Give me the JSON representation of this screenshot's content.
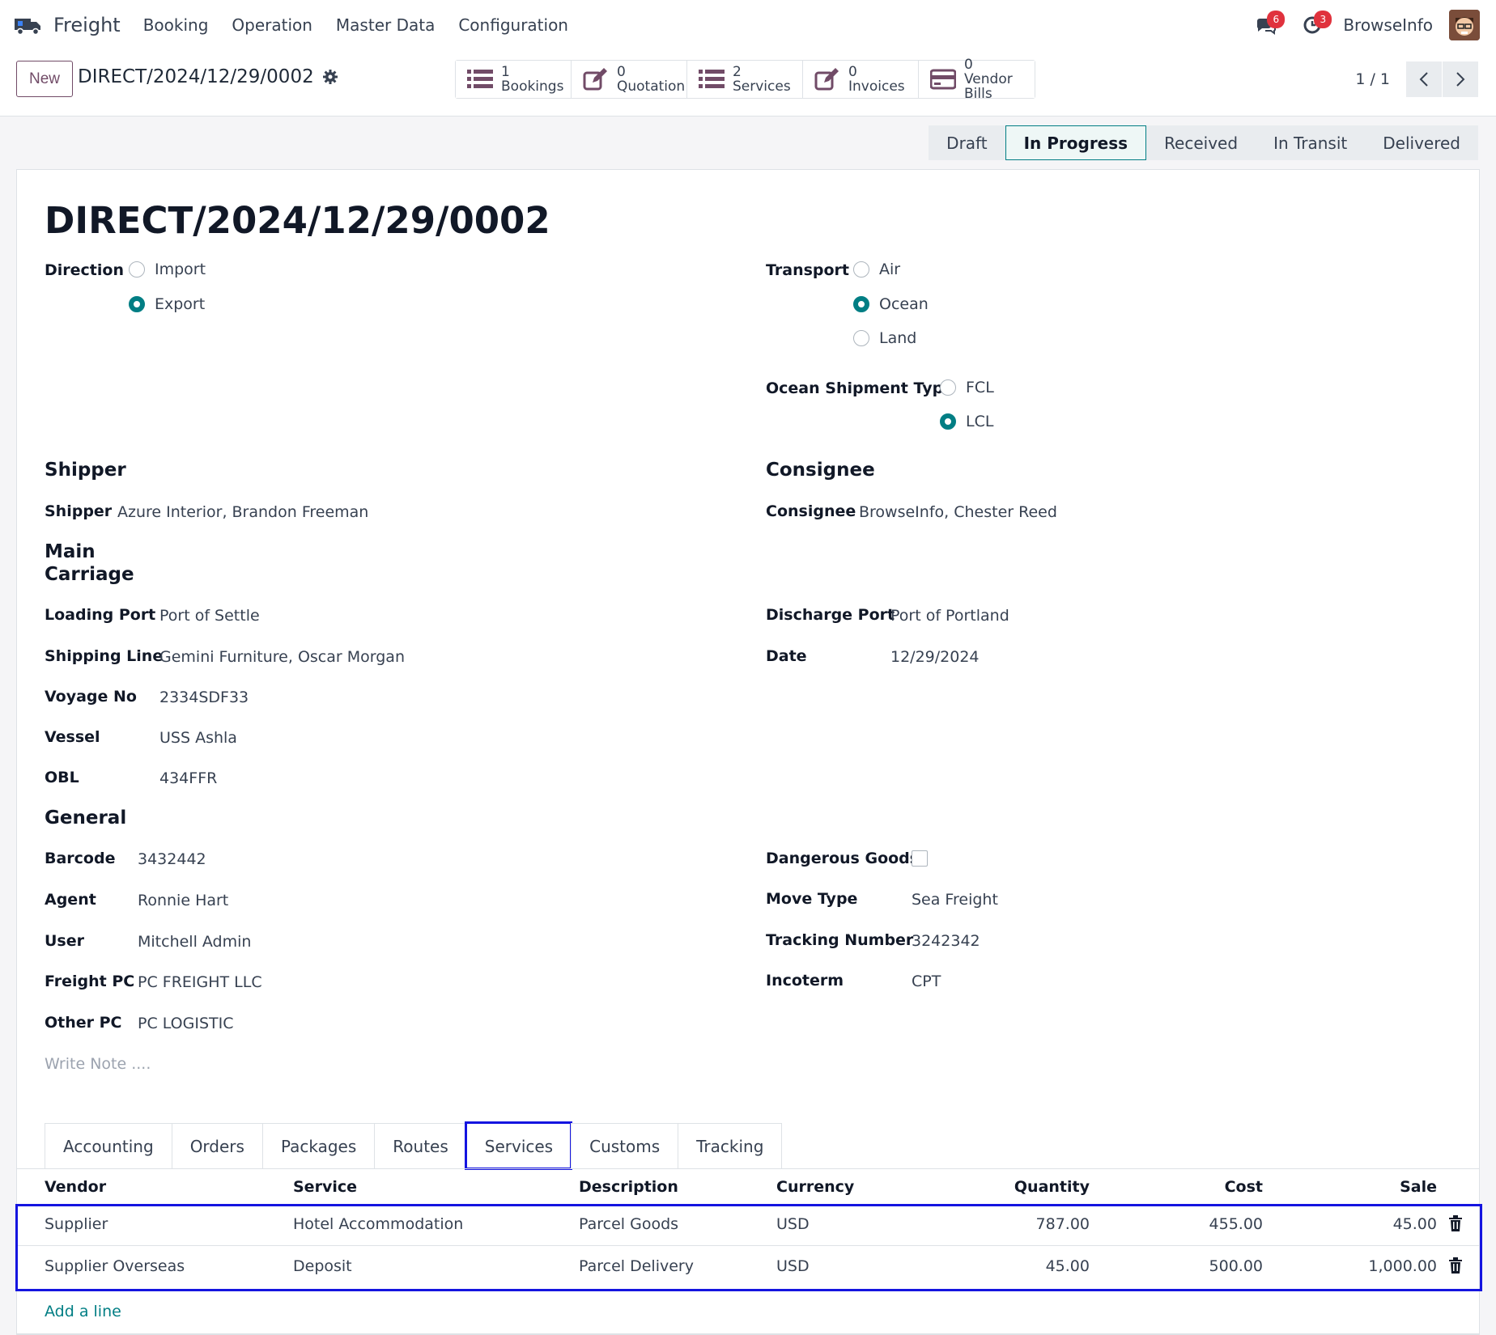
{
  "nav": {
    "app_name": "Freight",
    "menu": [
      "Booking",
      "Operation",
      "Master Data",
      "Configuration"
    ],
    "messages_badge": "6",
    "activities_badge": "3",
    "company": "BrowseInfo"
  },
  "control": {
    "new_label": "New",
    "record_name": "DIRECT/2024/12/29/0002",
    "smart_buttons": [
      {
        "count": "1",
        "label": "Bookings",
        "icon": "list-icon"
      },
      {
        "count": "0",
        "label": "Quotation",
        "icon": "edit-icon"
      },
      {
        "count": "2",
        "label": "Services",
        "icon": "list-icon"
      },
      {
        "count": "0",
        "label": "Invoices",
        "icon": "edit-icon"
      },
      {
        "count": "0",
        "label": "Vendor Bills",
        "icon": "credit-card-icon"
      }
    ],
    "pager": "1 / 1"
  },
  "status": {
    "stages": [
      "Draft",
      "In Progress",
      "Received",
      "In Transit",
      "Delivered"
    ],
    "active": "In Progress"
  },
  "form": {
    "title": "DIRECT/2024/12/29/0002",
    "direction_label": "Direction",
    "direction_options": [
      "Import",
      "Export"
    ],
    "direction_value": "Export",
    "transport_label": "Transport",
    "transport_options": [
      "Air",
      "Ocean",
      "Land"
    ],
    "transport_value": "Ocean",
    "ocean_type_label": "Ocean Shipment Type",
    "ocean_type_options": [
      "FCL",
      "LCL"
    ],
    "ocean_type_value": "LCL",
    "shipper_section": "Shipper",
    "shipper_label": "Shipper",
    "shipper_value": "Azure Interior, Brandon Freeman",
    "consignee_section": "Consignee",
    "consignee_label": "Consignee",
    "consignee_value": "BrowseInfo, Chester Reed",
    "main_carriage_line1": "Main",
    "main_carriage_line2": "Carriage",
    "loading_port_label": "Loading Port",
    "loading_port_value": "Port of Settle",
    "discharge_port_label": "Discharge Port",
    "discharge_port_value": "Port of Portland",
    "shipping_line_label": "Shipping Line",
    "shipping_line_value": "Gemini Furniture, Oscar Morgan",
    "date_label": "Date",
    "date_value": "12/29/2024",
    "voyage_label": "Voyage No",
    "voyage_value": "2334SDF33",
    "vessel_label": "Vessel",
    "vessel_value": "USS Ashla",
    "obl_label": "OBL",
    "obl_value": "434FFR",
    "general_section": "General",
    "barcode_label": "Barcode",
    "barcode_value": "3432442",
    "dangerous_label": "Dangerous Goods",
    "dangerous_value": false,
    "agent_label": "Agent",
    "agent_value": "Ronnie Hart",
    "move_type_label": "Move Type",
    "move_type_value": "Sea Freight",
    "user_label": "User",
    "user_value": "Mitchell Admin",
    "tracking_label": "Tracking Number",
    "tracking_value": "3242342",
    "freight_pc_label": "Freight PC",
    "freight_pc_value": "PC FREIGHT LLC",
    "incoterm_label": "Incoterm",
    "incoterm_value": "CPT",
    "other_pc_label": "Other PC",
    "other_pc_value": "PC LOGISTIC",
    "note_placeholder": "Write Note ...."
  },
  "tabs": [
    "Accounting",
    "Orders",
    "Packages",
    "Routes",
    "Services",
    "Customs",
    "Tracking"
  ],
  "active_tab": "Services",
  "services_table": {
    "columns": [
      "Vendor",
      "Service",
      "Description",
      "Currency",
      "Quantity",
      "Cost",
      "Sale"
    ],
    "rows": [
      {
        "vendor": "Supplier",
        "service": "Hotel Accommodation",
        "description": "Parcel Goods",
        "currency": "USD",
        "quantity": "787.00",
        "cost": "455.00",
        "sale": "45.00"
      },
      {
        "vendor": "Supplier Overseas",
        "service": "Deposit",
        "description": "Parcel Delivery",
        "currency": "USD",
        "quantity": "45.00",
        "cost": "500.00",
        "sale": "1,000.00"
      }
    ],
    "add_line": "Add a line"
  },
  "colors": {
    "accent": "#017e84",
    "brand": "#714b67",
    "highlight": "#1414e0"
  }
}
